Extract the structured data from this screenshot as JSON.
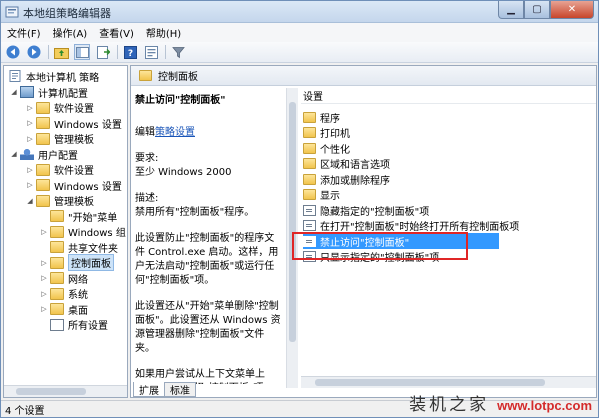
{
  "window": {
    "title": "本地组策略编辑器"
  },
  "menu": [
    "文件(F)",
    "操作(A)",
    "查看(V)",
    "帮助(H)"
  ],
  "tree": {
    "root": "本地计算机 策略",
    "items": [
      {
        "label": "计算机配置",
        "level": 1,
        "arrow": "◢",
        "icon": "computer-config"
      },
      {
        "label": "软件设置",
        "level": 2,
        "arrow": "▷",
        "icon": "folder"
      },
      {
        "label": "Windows 设置",
        "level": 2,
        "arrow": "▷",
        "icon": "folder"
      },
      {
        "label": "管理模板",
        "level": 2,
        "arrow": "▷",
        "icon": "folder"
      },
      {
        "label": "用户配置",
        "level": 1,
        "arrow": "◢",
        "icon": "user-config"
      },
      {
        "label": "软件设置",
        "level": 2,
        "arrow": "▷",
        "icon": "folder"
      },
      {
        "label": "Windows 设置",
        "level": 2,
        "arrow": "▷",
        "icon": "folder"
      },
      {
        "label": "管理模板",
        "level": 2,
        "arrow": "◢",
        "icon": "folder"
      },
      {
        "label": "\"开始\"菜单",
        "level": 3,
        "arrow": "",
        "icon": "folder"
      },
      {
        "label": "Windows 组",
        "level": 3,
        "arrow": "▷",
        "icon": "folder"
      },
      {
        "label": "共享文件夹",
        "level": 3,
        "arrow": "",
        "icon": "folder"
      },
      {
        "label": "控制面板",
        "level": 3,
        "arrow": "▷",
        "icon": "folder",
        "selected": true
      },
      {
        "label": "网络",
        "level": 3,
        "arrow": "▷",
        "icon": "folder"
      },
      {
        "label": "系统",
        "level": 3,
        "arrow": "▷",
        "icon": "folder"
      },
      {
        "label": "桌面",
        "level": 3,
        "arrow": "▷",
        "icon": "folder"
      },
      {
        "label": "所有设置",
        "level": 3,
        "arrow": "",
        "icon": "all-settings"
      }
    ]
  },
  "content": {
    "header": "控制面板",
    "description": {
      "title": "禁止访问\"控制面板\"",
      "edit_prefix": "编辑",
      "edit_link": "策略设置",
      "requirements_label": "要求:",
      "requirements_value": "至少 Windows 2000",
      "desc_label": "描述:",
      "desc_1": "禁用所有\"控制面板\"程序。",
      "desc_2": "此设置防止\"控制面板\"的程序文件 Control.exe 启动。这样，用户无法启动\"控制面板\"或运行任何\"控制面板\"项。",
      "desc_3": "此设置还从\"开始\"菜单删除\"控制面板\"。此设置还从 Windows 资源管理器删除\"控制面板\"文件夹。",
      "desc_4": "如果用户尝试从上下文菜单上的\"属性\"项选择\"控制面板\"项"
    },
    "tabs": [
      "扩展",
      "标准"
    ],
    "list_header": "设置",
    "settings": [
      {
        "label": "程序",
        "type": "folder"
      },
      {
        "label": "打印机",
        "type": "folder"
      },
      {
        "label": "个性化",
        "type": "folder"
      },
      {
        "label": "区域和语言选项",
        "type": "folder"
      },
      {
        "label": "添加或删除程序",
        "type": "folder"
      },
      {
        "label": "显示",
        "type": "folder"
      },
      {
        "label": "隐藏指定的\"控制面板\"项",
        "type": "setting"
      },
      {
        "label": "在打开\"控制面板\"时始终打开所有控制面板项",
        "type": "setting"
      },
      {
        "label": "禁止访问\"控制面板\"",
        "type": "setting",
        "selected": true
      },
      {
        "label": "只显示指定的\"控制面板\"项",
        "type": "setting"
      }
    ]
  },
  "status": "4 个设置",
  "watermark": {
    "text": "装机之家",
    "url": "www.lotpc.com"
  },
  "colors": {
    "selection": "#3399ff",
    "highlight_box": "#e02626",
    "link": "#1a55b8"
  }
}
